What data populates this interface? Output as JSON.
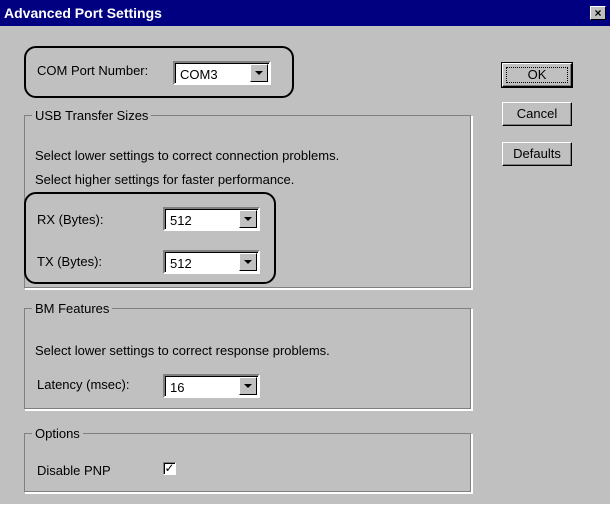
{
  "window": {
    "title": "Advanced Port Settings",
    "close_glyph": "×"
  },
  "com_port": {
    "label": "COM Port Number:",
    "value": "COM3"
  },
  "usb_group": {
    "legend": "USB Transfer Sizes",
    "hint1": "Select lower settings to correct connection problems.",
    "hint2": "Select higher settings for faster performance.",
    "rx_label": "RX (Bytes):",
    "rx_value": "512",
    "tx_label": "TX (Bytes):",
    "tx_value": "512"
  },
  "bm_group": {
    "legend": "BM Features",
    "hint": "Select lower settings to correct response problems.",
    "latency_label": "Latency (msec):",
    "latency_value": "16"
  },
  "options_group": {
    "legend": "Options",
    "disable_pnp_label": "Disable PNP",
    "disable_pnp_checked": true,
    "check_glyph": "✓"
  },
  "buttons": {
    "ok_label": "OK",
    "cancel_label": "Cancel",
    "defaults_label": "Defaults"
  },
  "colors": {
    "titlebar": "#000080",
    "face": "#c0c0c0",
    "highlight": "#000000"
  }
}
